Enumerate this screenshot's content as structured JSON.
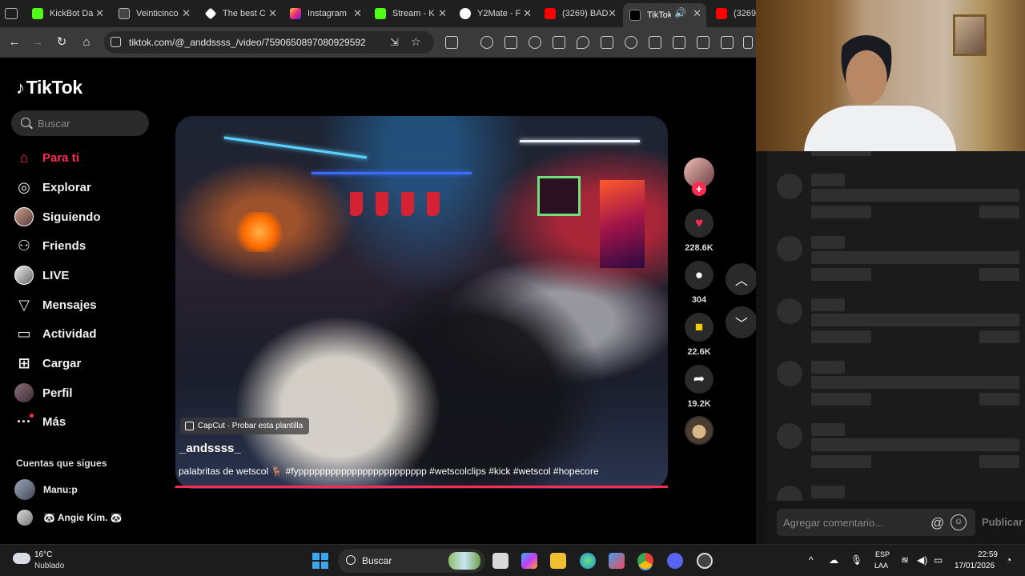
{
  "browser": {
    "tabs": [
      {
        "label": "KickBot Da",
        "color": "#53fc18",
        "active": false
      },
      {
        "label": "Veinticinco",
        "color": "#cfcfcf",
        "active": false
      },
      {
        "label": "The best C",
        "color": "#ffffff",
        "active": false
      },
      {
        "label": "Instagram",
        "color": "#e1306c",
        "active": false
      },
      {
        "label": "Stream - K",
        "color": "#53fc18",
        "active": false
      },
      {
        "label": "Y2Mate - F",
        "color": "#e0e0e0",
        "active": false
      },
      {
        "label": "(3269) BAD",
        "color": "#ff0000",
        "active": false
      },
      {
        "label": "TikTok",
        "color": "#ffffff",
        "active": true
      },
      {
        "label": "(3269)",
        "color": "#ff0000",
        "active": false
      }
    ],
    "url": "tiktok.com/@_anddssss_/video/7590650897080929592"
  },
  "sidebar": {
    "logo": "TikTok",
    "search_placeholder": "Buscar",
    "nav": [
      {
        "label": "Para ti",
        "icon": "home-icon",
        "active": true
      },
      {
        "label": "Explorar",
        "icon": "compass-icon",
        "active": false
      },
      {
        "label": "Siguiendo",
        "icon": "avatar-icon",
        "active": false
      },
      {
        "label": "Friends",
        "icon": "friends-icon",
        "active": false
      },
      {
        "label": "LIVE",
        "icon": "live-icon",
        "active": false
      },
      {
        "label": "Mensajes",
        "icon": "send-icon",
        "active": false
      },
      {
        "label": "Actividad",
        "icon": "activity-icon",
        "active": false
      },
      {
        "label": "Cargar",
        "icon": "upload-icon",
        "active": false
      },
      {
        "label": "Perfil",
        "icon": "profile-icon",
        "active": false
      },
      {
        "label": "Más",
        "icon": "more-icon",
        "active": false
      }
    ],
    "following_title": "Cuentas que sigues",
    "following": [
      {
        "name": "Manu:p"
      },
      {
        "name": "🐼 Angie Kim. 🐼"
      }
    ]
  },
  "video": {
    "capcut_label": "CapCut · Probar esta plantilla",
    "author": "_andssss_",
    "caption": "palabritas de wetscol 🦌 #fypppppppppppppppppppppppp #wetscolclips #kick #wetscol #hopecore",
    "progress_fraction": 1.0,
    "actions": {
      "likes": "228.6K",
      "comments": "304",
      "saves": "22.6K",
      "shares": "19.2K"
    },
    "accent_color": "#fe2c55"
  },
  "comments": {
    "placeholder": "Agregar comentario...",
    "publish_label": "Publicar",
    "at_symbol": "@",
    "loading_count": 6
  },
  "taskbar": {
    "weather_temp": "16°C",
    "weather_desc": "Nublado",
    "search_label": "Buscar",
    "lang_top": "ESP",
    "lang_bottom": "LAA",
    "time": "22:59",
    "date": "17/01/2026"
  }
}
